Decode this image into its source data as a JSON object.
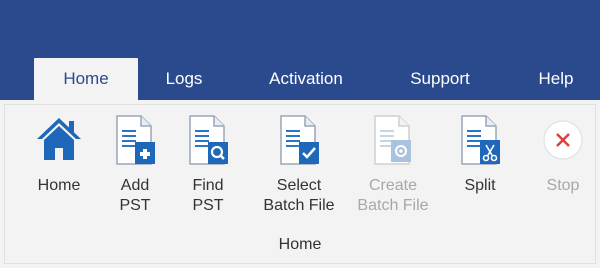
{
  "colors": {
    "title_bar": "#2b4a8e",
    "ribbon_bg": "#f3f3f3",
    "doc_blue": "#1f67b8",
    "disabled": "#b3b3b3",
    "stop_red": "#e04040"
  },
  "tabs": [
    {
      "label": "Home",
      "active": true
    },
    {
      "label": "Logs",
      "active": false
    },
    {
      "label": "Activation",
      "active": false
    },
    {
      "label": "Support",
      "active": false
    },
    {
      "label": "Help",
      "active": false
    }
  ],
  "ribbon": {
    "buttons": [
      {
        "label": "Home",
        "icon": "home-icon",
        "enabled": true
      },
      {
        "label": "Add\nPST",
        "icon": "add-pst-icon",
        "enabled": true
      },
      {
        "label": "Find\nPST",
        "icon": "find-pst-icon",
        "enabled": true
      },
      {
        "label": "Select\nBatch File",
        "icon": "select-batch-file-icon",
        "enabled": true
      },
      {
        "label": "Create\nBatch File",
        "icon": "create-batch-file-icon",
        "enabled": false
      },
      {
        "label": "Split",
        "icon": "split-icon",
        "enabled": true
      },
      {
        "label": "Stop",
        "icon": "stop-icon",
        "enabled": false
      }
    ],
    "group_label": "Home"
  }
}
